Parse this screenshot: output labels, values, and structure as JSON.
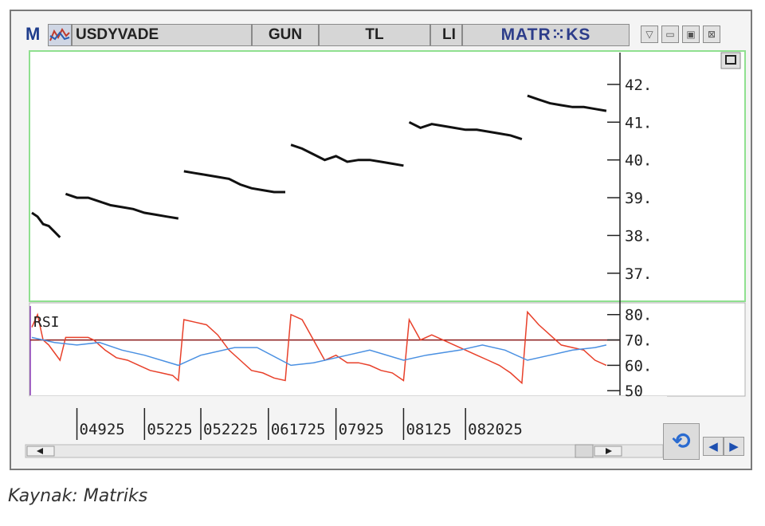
{
  "window": {
    "logo": "M",
    "symbol": "USDYVADE",
    "period": "GUN",
    "currency": "TL",
    "truncated_tab": "LI",
    "brand": "MATR⁙KS"
  },
  "caption": "Kaynak: Matriks",
  "colors": {
    "price": "#111111",
    "rsi": "#e8402a",
    "rsi_ma": "#4a90e2",
    "level_line": "#8b1a1a",
    "frame_green": "#8fe08f"
  },
  "chart_data": [
    {
      "type": "line",
      "title": "",
      "segments": [
        [
          [
            0,
            38.6
          ],
          [
            1,
            38.5
          ],
          [
            2,
            38.3
          ],
          [
            3,
            38.25
          ],
          [
            4,
            38.1
          ],
          [
            5,
            37.95
          ]
        ],
        [
          [
            6,
            39.1
          ],
          [
            8,
            39.0
          ],
          [
            10,
            39.0
          ],
          [
            12,
            38.9
          ],
          [
            14,
            38.8
          ],
          [
            16,
            38.75
          ],
          [
            18,
            38.7
          ],
          [
            20,
            38.6
          ],
          [
            22,
            38.55
          ],
          [
            24,
            38.5
          ],
          [
            26,
            38.45
          ]
        ],
        [
          [
            27,
            39.7
          ],
          [
            29,
            39.65
          ],
          [
            31,
            39.6
          ],
          [
            33,
            39.55
          ],
          [
            35,
            39.5
          ],
          [
            37,
            39.35
          ],
          [
            39,
            39.25
          ],
          [
            41,
            39.2
          ],
          [
            43,
            39.15
          ],
          [
            45,
            39.15
          ]
        ],
        [
          [
            46,
            40.4
          ],
          [
            48,
            40.3
          ],
          [
            50,
            40.15
          ],
          [
            52,
            40.0
          ],
          [
            54,
            40.1
          ],
          [
            56,
            39.95
          ],
          [
            58,
            40.0
          ],
          [
            60,
            40.0
          ],
          [
            62,
            39.95
          ],
          [
            64,
            39.9
          ],
          [
            66,
            39.85
          ]
        ],
        [
          [
            67,
            41.0
          ],
          [
            69,
            40.85
          ],
          [
            71,
            40.95
          ],
          [
            73,
            40.9
          ],
          [
            75,
            40.85
          ],
          [
            77,
            40.8
          ],
          [
            79,
            40.8
          ],
          [
            81,
            40.75
          ],
          [
            83,
            40.7
          ],
          [
            85,
            40.65
          ],
          [
            87,
            40.55
          ]
        ],
        [
          [
            88,
            41.7
          ],
          [
            90,
            41.6
          ],
          [
            92,
            41.5
          ],
          [
            94,
            41.45
          ],
          [
            96,
            41.4
          ],
          [
            98,
            41.4
          ],
          [
            100,
            41.35
          ],
          [
            102,
            41.3
          ]
        ]
      ],
      "y_ticks": [
        "42.",
        "41.",
        "40.",
        "39.",
        "38.",
        "37."
      ],
      "y_tick_values": [
        42,
        41,
        40,
        39,
        38,
        37
      ],
      "ylim": [
        36.3,
        42.8
      ],
      "xlim": [
        0,
        104
      ],
      "grid": false
    },
    {
      "type": "line",
      "title": "",
      "label": "RSI",
      "series": [
        {
          "values": [
            [
              0,
              75
            ],
            [
              1,
              80
            ],
            [
              2,
              70
            ],
            [
              3,
              68
            ],
            [
              4,
              65
            ],
            [
              5,
              62
            ],
            [
              6,
              71
            ],
            [
              8,
              71
            ],
            [
              10,
              71
            ],
            [
              11,
              70
            ],
            [
              13,
              66
            ],
            [
              15,
              63
            ],
            [
              17,
              62
            ],
            [
              19,
              60
            ],
            [
              21,
              58
            ],
            [
              23,
              57
            ],
            [
              25,
              56
            ],
            [
              26,
              54
            ],
            [
              27,
              78
            ],
            [
              29,
              77
            ],
            [
              31,
              76
            ],
            [
              33,
              72
            ],
            [
              35,
              66
            ],
            [
              37,
              62
            ],
            [
              39,
              58
            ],
            [
              41,
              57
            ],
            [
              43,
              55
            ],
            [
              45,
              54
            ],
            [
              46,
              80
            ],
            [
              48,
              78
            ],
            [
              50,
              70
            ],
            [
              52,
              62
            ],
            [
              54,
              64
            ],
            [
              56,
              61
            ],
            [
              58,
              61
            ],
            [
              60,
              60
            ],
            [
              62,
              58
            ],
            [
              64,
              57
            ],
            [
              66,
              54
            ],
            [
              67,
              78
            ],
            [
              69,
              70
            ],
            [
              71,
              72
            ],
            [
              73,
              70
            ],
            [
              75,
              68
            ],
            [
              77,
              66
            ],
            [
              79,
              64
            ],
            [
              81,
              62
            ],
            [
              83,
              60
            ],
            [
              85,
              57
            ],
            [
              87,
              53
            ],
            [
              88,
              81
            ],
            [
              90,
              76
            ],
            [
              92,
              72
            ],
            [
              94,
              68
            ],
            [
              96,
              67
            ],
            [
              98,
              66
            ],
            [
              100,
              62
            ],
            [
              102,
              60
            ]
          ]
        },
        {
          "values": [
            [
              0,
              71
            ],
            [
              4,
              69
            ],
            [
              8,
              68
            ],
            [
              12,
              69
            ],
            [
              16,
              66
            ],
            [
              20,
              64
            ],
            [
              26,
              60
            ],
            [
              30,
              64
            ],
            [
              36,
              67
            ],
            [
              40,
              67
            ],
            [
              46,
              60
            ],
            [
              50,
              61
            ],
            [
              56,
              64
            ],
            [
              60,
              66
            ],
            [
              66,
              62
            ],
            [
              70,
              64
            ],
            [
              76,
              66
            ],
            [
              80,
              68
            ],
            [
              84,
              66
            ],
            [
              88,
              62
            ],
            [
              92,
              64
            ],
            [
              96,
              66
            ],
            [
              100,
              67
            ],
            [
              102,
              68
            ]
          ]
        }
      ],
      "levels": [
        70
      ],
      "y_ticks": [
        "80.",
        "70.",
        "60.",
        "50"
      ],
      "y_tick_values": [
        80,
        70,
        60,
        50
      ],
      "ylim": [
        48.5,
        84
      ],
      "xlim": [
        0,
        104
      ]
    }
  ],
  "x_ticks": [
    "04925",
    "05225",
    "052225",
    "061725",
    "07925",
    "08125",
    "082025"
  ],
  "x_tick_positions": [
    8,
    20,
    30,
    42,
    54,
    66,
    77
  ]
}
